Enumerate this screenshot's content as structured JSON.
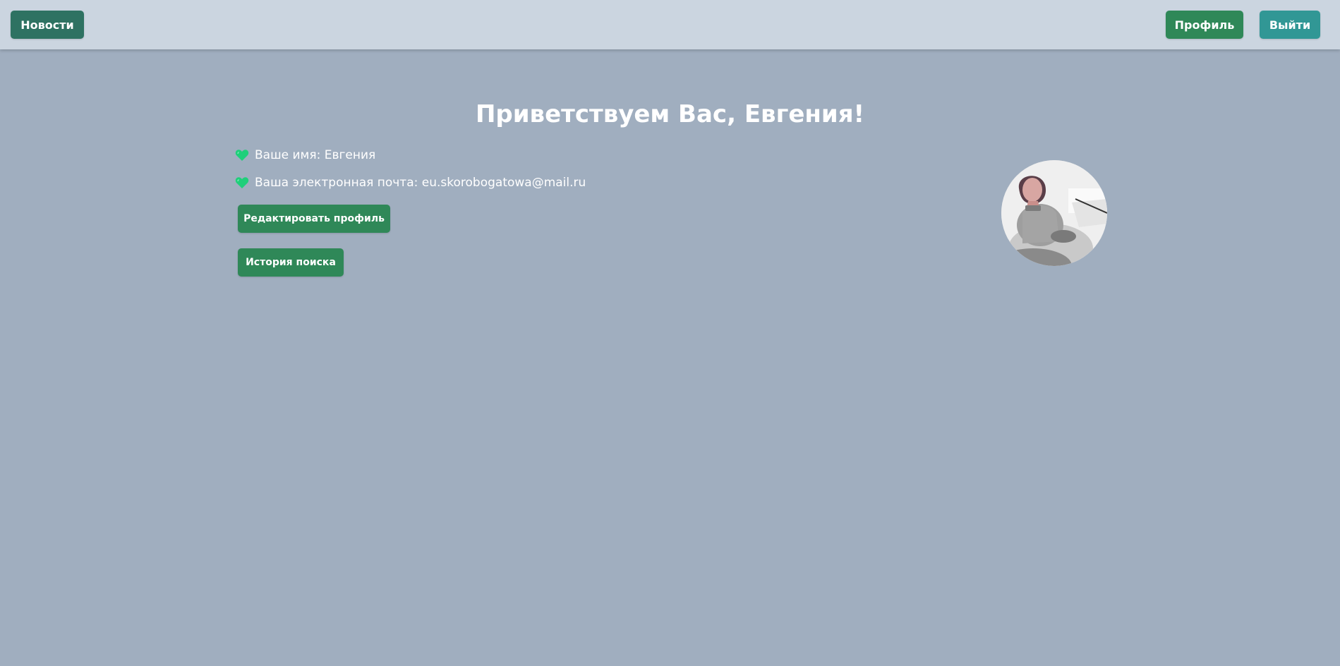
{
  "header": {
    "news_label": "Новости",
    "profile_label": "Профиль",
    "logout_label": "Выйти"
  },
  "main": {
    "welcome": "Приветствуем Вас, Евгения!",
    "name_line": "Ваше имя: Евгения",
    "email_line": "Ваша электронная почта: eu.skorobogatowa@mail.ru",
    "edit_profile_label": "Редактировать профиль",
    "search_history_label": "История поиска",
    "bullet_icon": "green-heart-icon",
    "avatar_icon": "user-photo"
  },
  "colors": {
    "background": "#a0aebf",
    "header": "#cbd5e0",
    "news_button": "#2e7262",
    "profile_button": "#2f8858",
    "logout_button": "#319795",
    "action_button": "#2f8858",
    "heart": "#1fcf7a"
  }
}
